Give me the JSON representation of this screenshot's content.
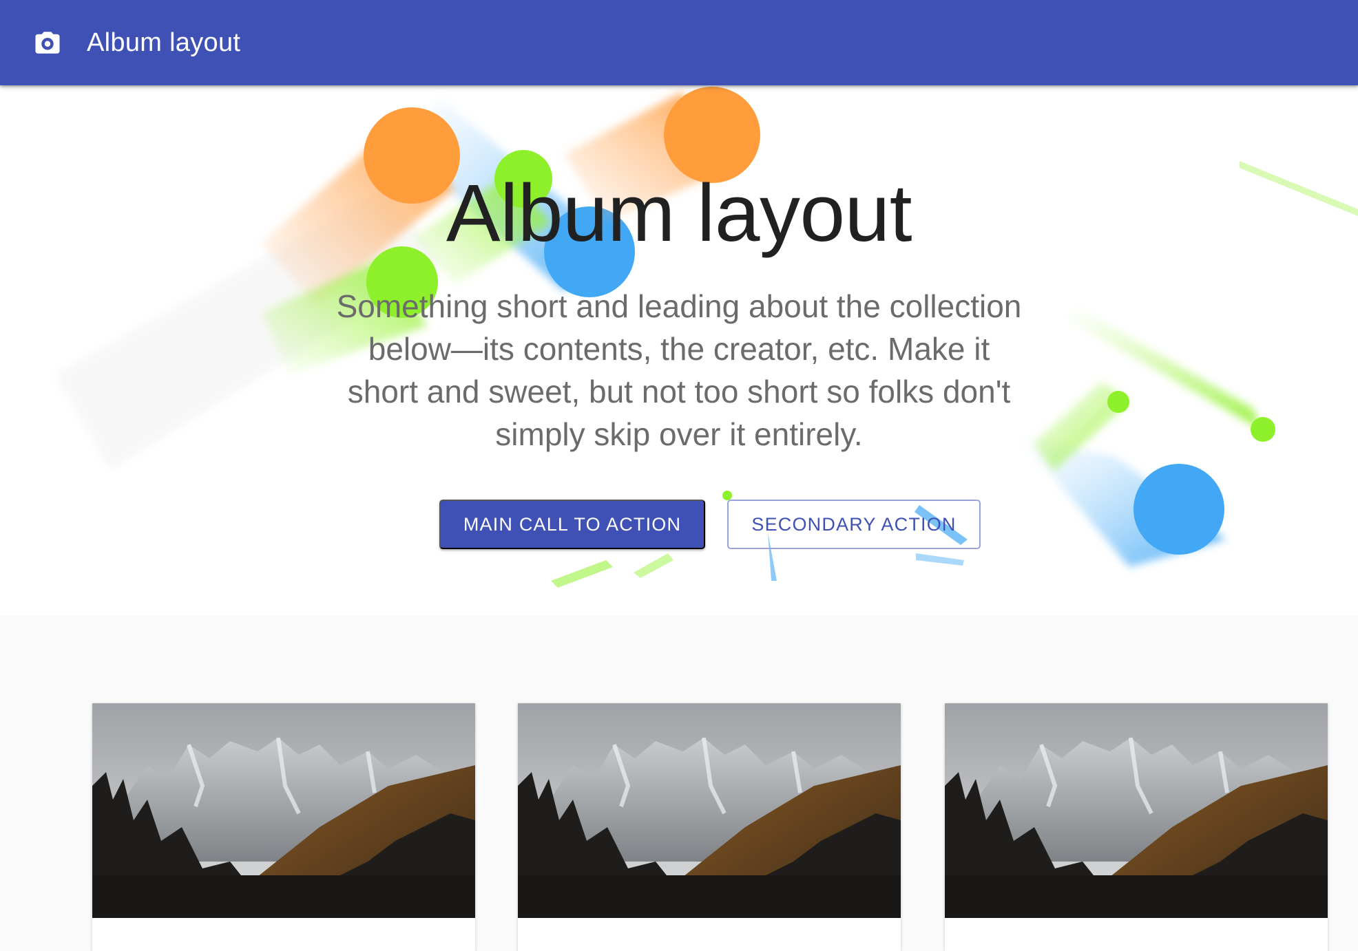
{
  "appbar": {
    "icon": "camera-icon",
    "title": "Album layout",
    "color": "#3f51b5"
  },
  "hero": {
    "title": "Album layout",
    "subtitle": "Something short and leading about the collection below—its contents, the creator, etc. Make it short and sweet, but not too short so folks don't simply skip over it entirely.",
    "primary_button": "MAIN CALL TO ACTION",
    "secondary_button": "SECONDARY ACTION"
  },
  "cards": [
    {
      "image": "mountain-landscape"
    },
    {
      "image": "mountain-landscape"
    },
    {
      "image": "mountain-landscape"
    }
  ],
  "colors": {
    "primary": "#3f51b5",
    "orange": "#ff9d3d",
    "green": "#8ef02a",
    "blue": "#42a8f5"
  }
}
